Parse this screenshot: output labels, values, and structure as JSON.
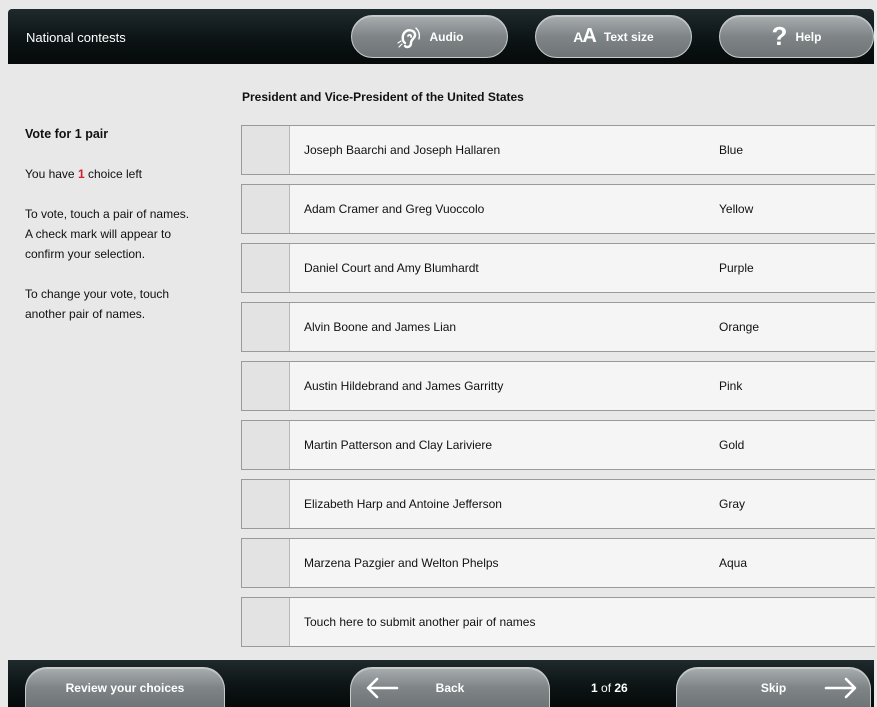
{
  "header": {
    "title": "National contests",
    "audio_label": "Audio",
    "text_size_label": "Text size",
    "text_size_glyph": "AA",
    "help_label": "Help",
    "help_glyph": "?"
  },
  "contest": {
    "title": "President and Vice-President of the United States"
  },
  "instructions": {
    "vote_for": "Vote for 1 pair",
    "choices_prefix": "You have ",
    "choices_count": "1",
    "choices_suffix": " choice left",
    "how_to_vote": [
      "To vote, touch a pair of names.",
      "A check mark will appear to",
      "confirm your selection."
    ],
    "how_to_change": [
      "To change your vote, touch",
      "another pair of names."
    ]
  },
  "candidates": [
    {
      "name": "Joseph Baarchi and Joseph Hallaren",
      "party": "Blue"
    },
    {
      "name": "Adam Cramer and Greg Vuoccolo",
      "party": "Yellow"
    },
    {
      "name": "Daniel Court and Amy Blumhardt",
      "party": "Purple"
    },
    {
      "name": "Alvin Boone and James Lian",
      "party": "Orange"
    },
    {
      "name": "Austin Hildebrand and James Garritty",
      "party": "Pink"
    },
    {
      "name": "Martin Patterson and Clay Lariviere",
      "party": "Gold"
    },
    {
      "name": "Elizabeth Harp and Antoine Jefferson",
      "party": "Gray"
    },
    {
      "name": "Marzena Pazgier and Welton Phelps",
      "party": "Aqua"
    }
  ],
  "write_in": {
    "label": "Touch here to submit another pair of names"
  },
  "footer": {
    "review_label": "Review your choices",
    "back_label": "Back",
    "skip_label": "Skip",
    "page_current": "1",
    "page_of": " of ",
    "page_total": "26"
  },
  "icons": {
    "audio": "ear-icon",
    "text_size": "text-size-icon",
    "help": "question-mark-icon",
    "back": "arrow-left-icon",
    "skip": "arrow-right-icon"
  },
  "colors": {
    "accent_red": "#d4202a",
    "bar_dark": "#0c1415",
    "pill_gray": "#7f8587"
  }
}
